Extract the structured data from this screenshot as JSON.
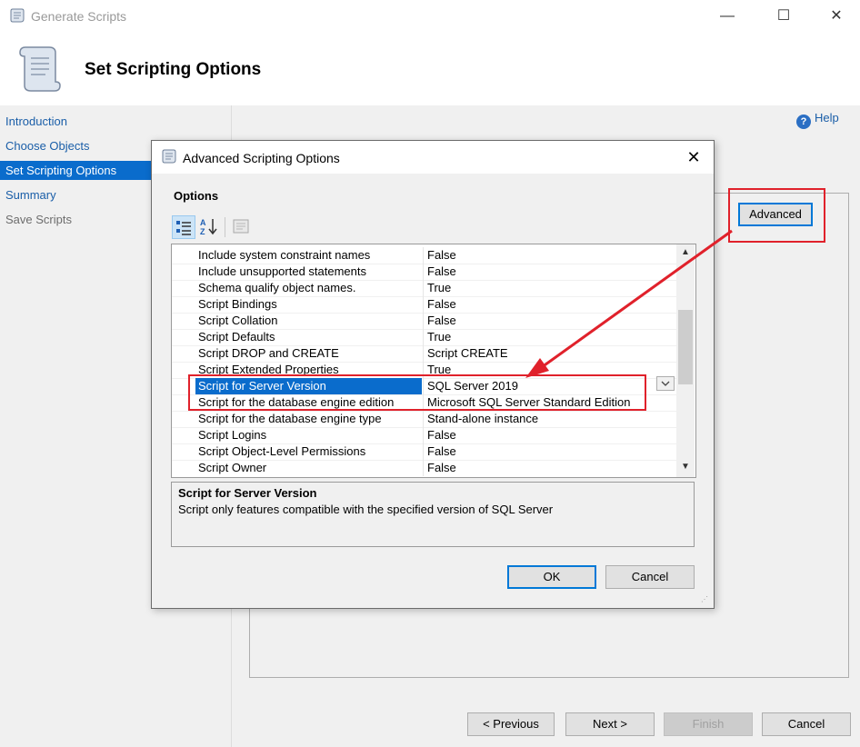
{
  "window": {
    "title": "Generate Scripts",
    "minimize_glyph": "—",
    "maximize_glyph": "☐",
    "close_glyph": "✕"
  },
  "header": {
    "title": "Set Scripting Options"
  },
  "nav": {
    "items": [
      {
        "label": "Introduction",
        "state": "normal"
      },
      {
        "label": "Choose Objects",
        "state": "normal"
      },
      {
        "label": "Set Scripting Options",
        "state": "selected"
      },
      {
        "label": "Summary",
        "state": "normal"
      },
      {
        "label": "Save Scripts",
        "state": "disabled"
      }
    ]
  },
  "help": {
    "label": "Help"
  },
  "advanced_button": {
    "label": "Advanced"
  },
  "dialog": {
    "title": "Advanced Scripting Options",
    "close_glyph": "✕",
    "options_label": "Options",
    "rows": [
      {
        "name": "Include system constraint names",
        "value": "False"
      },
      {
        "name": "Include unsupported statements",
        "value": "False"
      },
      {
        "name": "Schema qualify object names.",
        "value": "True"
      },
      {
        "name": "Script Bindings",
        "value": "False"
      },
      {
        "name": "Script Collation",
        "value": "False"
      },
      {
        "name": "Script Defaults",
        "value": "True"
      },
      {
        "name": "Script DROP and CREATE",
        "value": "Script CREATE"
      },
      {
        "name": "Script Extended Properties",
        "value": "True"
      },
      {
        "name": "Script for Server Version",
        "value": "SQL Server 2019",
        "selected": true
      },
      {
        "name": "Script for the database engine edition",
        "value": "Microsoft SQL Server Standard Edition"
      },
      {
        "name": "Script for the database engine type",
        "value": "Stand-alone instance"
      },
      {
        "name": "Script Logins",
        "value": "False"
      },
      {
        "name": "Script Object-Level Permissions",
        "value": "False"
      },
      {
        "name": "Script Owner",
        "value": "False"
      }
    ],
    "description": {
      "title": "Script for Server Version",
      "text": "Script only features compatible with the specified version of SQL Server"
    },
    "ok_label": "OK",
    "cancel_label": "Cancel"
  },
  "footer": {
    "previous_label": "< Previous",
    "next_label": "Next >",
    "finish_label": "Finish",
    "cancel_label": "Cancel"
  },
  "annotation_color": "#e0212b",
  "selection_color": "#0a6ccc"
}
